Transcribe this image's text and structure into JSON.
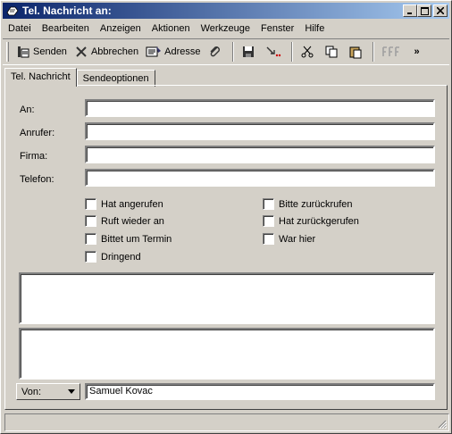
{
  "window": {
    "title": "Tel. Nachricht an:"
  },
  "menu": [
    "Datei",
    "Bearbeiten",
    "Anzeigen",
    "Aktionen",
    "Werkzeuge",
    "Fenster",
    "Hilfe"
  ],
  "toolbar": {
    "send_label": "Senden",
    "cancel_label": "Abbrechen",
    "address_label": "Adresse",
    "overflow": "»"
  },
  "tabs": [
    {
      "label": "Tel. Nachricht",
      "active": true
    },
    {
      "label": "Sendeoptionen",
      "active": false
    }
  ],
  "fields": {
    "an": {
      "label": "An:",
      "value": ""
    },
    "anrufer": {
      "label": "Anrufer:",
      "value": ""
    },
    "firma": {
      "label": "Firma:",
      "value": ""
    },
    "telefon": {
      "label": "Telefon:",
      "value": ""
    }
  },
  "checkboxes_left": [
    {
      "label": "Hat angerufen",
      "checked": false
    },
    {
      "label": "Ruft wieder an",
      "checked": false
    },
    {
      "label": "Bittet um Termin",
      "checked": false
    },
    {
      "label": "Dringend",
      "checked": false
    }
  ],
  "checkboxes_right": [
    {
      "label": "Bitte zurückrufen",
      "checked": false
    },
    {
      "label": "Hat zurückgerufen",
      "checked": false
    },
    {
      "label": "War hier",
      "checked": false
    }
  ],
  "from": {
    "button_label": "Von:",
    "value": "Samuel Kovac"
  },
  "colors": {
    "face": "#d4d0c8",
    "title_start": "#0a246a",
    "title_end": "#a6caf0"
  }
}
